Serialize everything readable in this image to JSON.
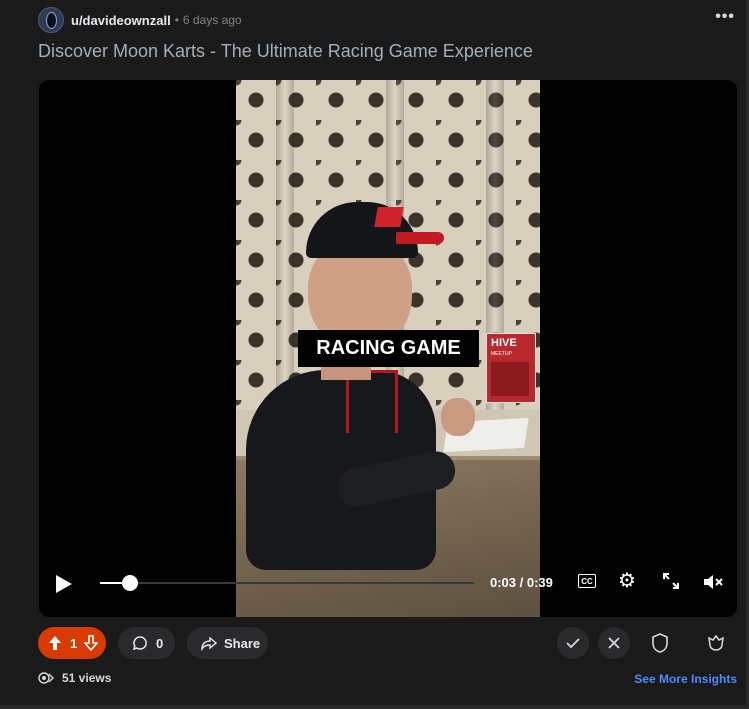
{
  "post": {
    "username": "u/davideownzall",
    "separator": "•",
    "time_ago": "6 days ago",
    "more_label": "•••",
    "title": "Discover Moon Karts - The Ultimate Racing Game Experience"
  },
  "video": {
    "caption": "RACING GAME",
    "poster_text": "HIVE",
    "poster_subtext": "MEETUP",
    "time_display": "0:03 / 0:39",
    "progress_fraction": 0.08,
    "cc_label": "CC",
    "muted": true
  },
  "actions": {
    "vote_count": "1",
    "comment_count": "0",
    "share_label": "Share",
    "views": "51 views",
    "insights_label": "See More Insights"
  },
  "colors": {
    "upvote_bg": "#d93a00",
    "link": "#4f8bff",
    "title": "#9fb0bd"
  }
}
